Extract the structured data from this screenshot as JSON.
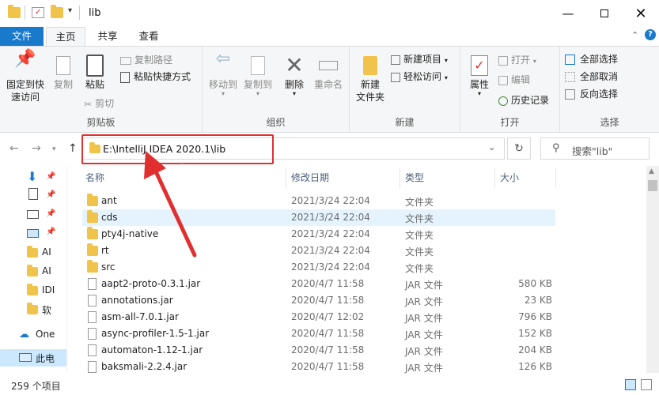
{
  "window": {
    "title": "lib",
    "qa_separator": "▾"
  },
  "tabs": [
    {
      "label": "文件"
    },
    {
      "label": "主页"
    },
    {
      "label": "共享"
    },
    {
      "label": "查看"
    }
  ],
  "ribbon": {
    "clipboard": {
      "pin": "固定到快速访问",
      "pin_l1": "固定到快",
      "pin_l2": "速访问",
      "copy": "复制",
      "paste": "粘贴",
      "copy_path": "复制路径",
      "paste_shortcut": "粘贴快捷方式",
      "cut": "剪切",
      "label": "剪贴板"
    },
    "organize": {
      "move_to": "移动到",
      "copy_to": "复制到",
      "delete": "删除",
      "rename": "重命名",
      "label": "组织"
    },
    "new": {
      "new_folder_l1": "新建",
      "new_folder_l2": "文件夹",
      "new_item": "新建项目",
      "easy_access": "轻松访问",
      "label": "新建"
    },
    "open": {
      "properties": "属性",
      "open": "打开",
      "edit": "编辑",
      "history": "历史记录",
      "label": "打开"
    },
    "select": {
      "select_all": "全部选择",
      "select_none": "全部取消",
      "invert": "反向选择",
      "label": "选择"
    }
  },
  "address": {
    "path": "E:\\IntelliJ IDEA 2020.1\\lib",
    "search_placeholder": "搜索\"lib\""
  },
  "navpane": {
    "items": [
      "AI",
      "AI",
      "IDI",
      "软",
      "One",
      "此电"
    ]
  },
  "columns": {
    "name": "名称",
    "modified": "修改日期",
    "type": "类型",
    "size": "大小"
  },
  "files": [
    {
      "name": "ant",
      "date": "2021/3/24 22:04",
      "type": "文件夹",
      "size": "",
      "kind": "folder"
    },
    {
      "name": "cds",
      "date": "2021/3/24 22:04",
      "type": "文件夹",
      "size": "",
      "kind": "folder"
    },
    {
      "name": "pty4j-native",
      "date": "2021/3/24 22:04",
      "type": "文件夹",
      "size": "",
      "kind": "folder"
    },
    {
      "name": "rt",
      "date": "2021/3/24 22:04",
      "type": "文件夹",
      "size": "",
      "kind": "folder"
    },
    {
      "name": "src",
      "date": "2021/3/24 22:04",
      "type": "文件夹",
      "size": "",
      "kind": "folder"
    },
    {
      "name": "aapt2-proto-0.3.1.jar",
      "date": "2020/4/7 11:58",
      "type": "JAR 文件",
      "size": "580 KB",
      "kind": "jar"
    },
    {
      "name": "annotations.jar",
      "date": "2020/4/7 11:58",
      "type": "JAR 文件",
      "size": "23 KB",
      "kind": "jar"
    },
    {
      "name": "asm-all-7.0.1.jar",
      "date": "2020/4/7 12:02",
      "type": "JAR 文件",
      "size": "796 KB",
      "kind": "jar"
    },
    {
      "name": "async-profiler-1.5-1.jar",
      "date": "2020/4/7 11:58",
      "type": "JAR 文件",
      "size": "152 KB",
      "kind": "jar"
    },
    {
      "name": "automaton-1.12-1.jar",
      "date": "2020/4/7 11:58",
      "type": "JAR 文件",
      "size": "204 KB",
      "kind": "jar"
    },
    {
      "name": "baksmali-2.2.4.jar",
      "date": "2020/4/7 11:58",
      "type": "JAR 文件",
      "size": "126 KB",
      "kind": "jar"
    }
  ],
  "status": {
    "count": "259 个项目"
  },
  "colors": {
    "accent": "#1979ca",
    "highlight": "#e12f2f",
    "folder": "#f0c44b"
  }
}
